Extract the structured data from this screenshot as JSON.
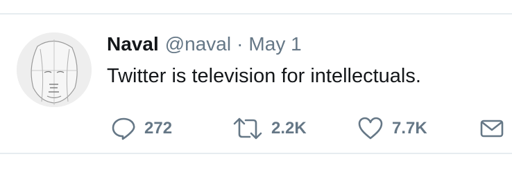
{
  "tweet": {
    "author_name": "Naval",
    "author_handle": "@naval",
    "separator": "·",
    "date": "May 1",
    "text": "Twitter is television for intellectuals."
  },
  "actions": {
    "reply_count": "272",
    "retweet_count": "2.2K",
    "like_count": "7.7K"
  },
  "icons": {
    "reply": "speech-bubble-icon",
    "retweet": "retweet-arrows-icon",
    "like": "heart-icon",
    "dm": "envelope-icon"
  },
  "colors": {
    "text_primary": "#14171a",
    "text_secondary": "#657786",
    "divider": "#e6ecf0"
  }
}
